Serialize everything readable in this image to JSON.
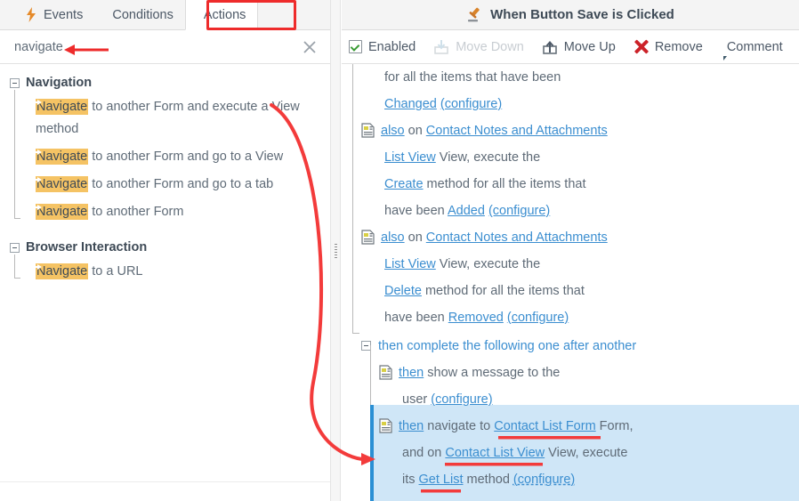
{
  "tabs": [
    {
      "label": "Events",
      "icon": "bolt-icon",
      "active": false
    },
    {
      "label": "Conditions",
      "icon": "diamond-icon",
      "active": false
    },
    {
      "label": "Actions",
      "icon": "arrow-circle-icon",
      "active": true
    }
  ],
  "search": {
    "value": "navigate",
    "placeholder": "",
    "clear_icon": "close-icon"
  },
  "left_tree": {
    "groups": [
      {
        "label": "Navigation",
        "expander": "collapse-icon",
        "items": [
          {
            "highlight": "Navigate",
            "rest": " to another Form and execute a View method"
          },
          {
            "highlight": "Navigate",
            "rest": " to another Form and go to a View"
          },
          {
            "highlight": "Navigate",
            "rest": " to another Form and go to a tab"
          },
          {
            "highlight": "Navigate",
            "rest": " to another Form"
          }
        ]
      },
      {
        "label": "Browser Interaction",
        "expander": "collapse-icon",
        "items": [
          {
            "highlight": "Navigate",
            "rest": " to a URL"
          }
        ]
      }
    ]
  },
  "right_header": {
    "icon": "gavel-icon",
    "title": "When Button Save is Clicked"
  },
  "toolbar": {
    "enabled_label": "Enabled",
    "enabled_checked": true,
    "move_down_label": "Move Down",
    "move_down_disabled": true,
    "move_up_label": "Move Up",
    "remove_label": "Remove",
    "comment_label": "Comment"
  },
  "action_tree": {
    "lines": [
      {
        "id": "l1",
        "icon": null,
        "indent": 1,
        "parts": [
          {
            "t": "text",
            "v": "for all the items that have been"
          }
        ]
      },
      {
        "id": "l2",
        "icon": null,
        "indent": 1,
        "parts": [
          {
            "t": "link",
            "v": "Changed"
          },
          {
            "t": "text",
            "v": " "
          },
          {
            "t": "link",
            "v": "(configure)"
          }
        ]
      },
      {
        "id": "l3",
        "icon": "document-icon",
        "indent": 0,
        "parts": [
          {
            "t": "link",
            "v": "also"
          },
          {
            "t": "text",
            "v": " on "
          },
          {
            "t": "link",
            "v": "Contact Notes and Attachments"
          }
        ]
      },
      {
        "id": "l4",
        "icon": null,
        "indent": 1,
        "parts": [
          {
            "t": "link",
            "v": "List View"
          },
          {
            "t": "text",
            "v": " View, execute the"
          }
        ]
      },
      {
        "id": "l5",
        "icon": null,
        "indent": 1,
        "parts": [
          {
            "t": "link",
            "v": "Create"
          },
          {
            "t": "text",
            "v": " method for all the items that"
          }
        ]
      },
      {
        "id": "l6",
        "icon": null,
        "indent": 1,
        "parts": [
          {
            "t": "text",
            "v": "have been "
          },
          {
            "t": "link",
            "v": "Added"
          },
          {
            "t": "text",
            "v": " "
          },
          {
            "t": "link",
            "v": "(configure)"
          }
        ]
      },
      {
        "id": "l7",
        "icon": "document-icon",
        "indent": 0,
        "parts": [
          {
            "t": "link",
            "v": "also"
          },
          {
            "t": "text",
            "v": " on "
          },
          {
            "t": "link",
            "v": "Contact Notes and Attachments"
          }
        ]
      },
      {
        "id": "l8",
        "icon": null,
        "indent": 1,
        "parts": [
          {
            "t": "link",
            "v": "List View"
          },
          {
            "t": "text",
            "v": " View, execute the"
          }
        ]
      },
      {
        "id": "l9",
        "icon": null,
        "indent": 1,
        "parts": [
          {
            "t": "link",
            "v": "Delete"
          },
          {
            "t": "text",
            "v": " method for all the items that"
          }
        ]
      },
      {
        "id": "l10",
        "icon": null,
        "indent": 1,
        "parts": [
          {
            "t": "text",
            "v": "have been "
          },
          {
            "t": "link",
            "v": "Removed"
          },
          {
            "t": "text",
            "v": " "
          },
          {
            "t": "link",
            "v": "(configure)"
          }
        ]
      }
    ],
    "group_line": {
      "expander": "collapse-icon",
      "label": "then complete the following one after another"
    },
    "child_lines": [
      {
        "id": "c1",
        "icon": "document-icon",
        "indent": 0,
        "selected": false,
        "parts": [
          {
            "t": "link",
            "v": "then"
          },
          {
            "t": "text",
            "v": " show a message to the"
          }
        ]
      },
      {
        "id": "c2",
        "icon": null,
        "indent": 1,
        "selected": false,
        "parts": [
          {
            "t": "text",
            "v": "user "
          },
          {
            "t": "link",
            "v": "(configure)"
          }
        ]
      },
      {
        "id": "c3",
        "icon": "document-icon",
        "indent": 0,
        "selected": true,
        "parts": [
          {
            "t": "link",
            "v": "then"
          },
          {
            "t": "text",
            "v": " navigate to "
          },
          {
            "t": "link",
            "v": "Contact List Form"
          },
          {
            "t": "text",
            "v": " Form,"
          }
        ]
      },
      {
        "id": "c4",
        "icon": null,
        "indent": 1,
        "selected": true,
        "parts": [
          {
            "t": "text",
            "v": "and on "
          },
          {
            "t": "link",
            "v": "Contact List View"
          },
          {
            "t": "text",
            "v": " View, execute"
          }
        ]
      },
      {
        "id": "c5",
        "icon": null,
        "indent": 1,
        "selected": true,
        "parts": [
          {
            "t": "text",
            "v": "its "
          },
          {
            "t": "link",
            "v": "Get List"
          },
          {
            "t": "text",
            "v": " method "
          },
          {
            "t": "link dashed",
            "v": "(configure)"
          }
        ]
      }
    ]
  },
  "annotations": {
    "accent_red": "#ee2b2b",
    "tab_box": "Actions tab highlighted",
    "search_arrow": "arrow pointing at search text",
    "curved_arrow": "curve from Navigate item to selected navigate action",
    "underlines": [
      "Contact List Form",
      "Contact List View",
      "Get List"
    ]
  },
  "colors": {
    "highlight_amber": "#f5c364",
    "link_blue": "#3b8ed0",
    "selection_bg": "#cfe6f7",
    "selection_border": "#2a8fd4",
    "purple_icon": "#9b4f9b"
  }
}
